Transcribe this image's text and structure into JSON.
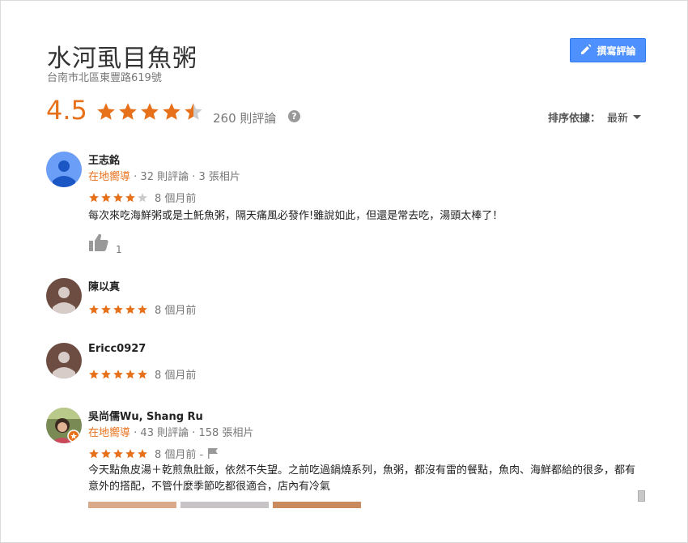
{
  "place": {
    "title": "水河虱目魚粥",
    "address": "台南市北區東豐路619號"
  },
  "write_review_button": {
    "label": "撰寫評論",
    "icon": "pencil-icon"
  },
  "summary": {
    "rating": "4.5",
    "stars": 4.5,
    "review_count": "260 則評論",
    "help_icon": "?"
  },
  "sort": {
    "label": "排序依據：",
    "value": "最新"
  },
  "colors": {
    "star": "#e7711b",
    "star_empty": "#cccccc",
    "button": "#4d90fe",
    "local_guide": "#e7711b"
  },
  "reviews": [
    {
      "name": "王志銘",
      "local_guide": "在地嚮導",
      "stats": "· 32 則評論 · 3 張相片",
      "stars": 4,
      "date": "8 個月前",
      "text": "每次來吃海鮮粥或是土魠魚粥，隔天痛風必發作!雖說如此，但還是常去吃，湯頭太棒了！",
      "likes": "1"
    },
    {
      "name": "陳以真",
      "stars": 5,
      "date": "8 個月前"
    },
    {
      "name": "Ericc0927",
      "stars": 5,
      "date": "8 個月前"
    },
    {
      "name": "吳尚儒Wu, Shang Ru",
      "local_guide": "在地嚮導",
      "stats": "· 43 則評論 · 158 張相片",
      "stars": 5,
      "date": "8 個月前 -",
      "text": "今天點魚皮湯＋乾煎魚肚飯，依然不失望。之前吃過鍋燒系列，魚粥，都沒有雷的餐點，魚肉、海鮮都給的很多，都有意外的搭配，不管什麼季節吃都很適合，店內有冷氣"
    }
  ]
}
